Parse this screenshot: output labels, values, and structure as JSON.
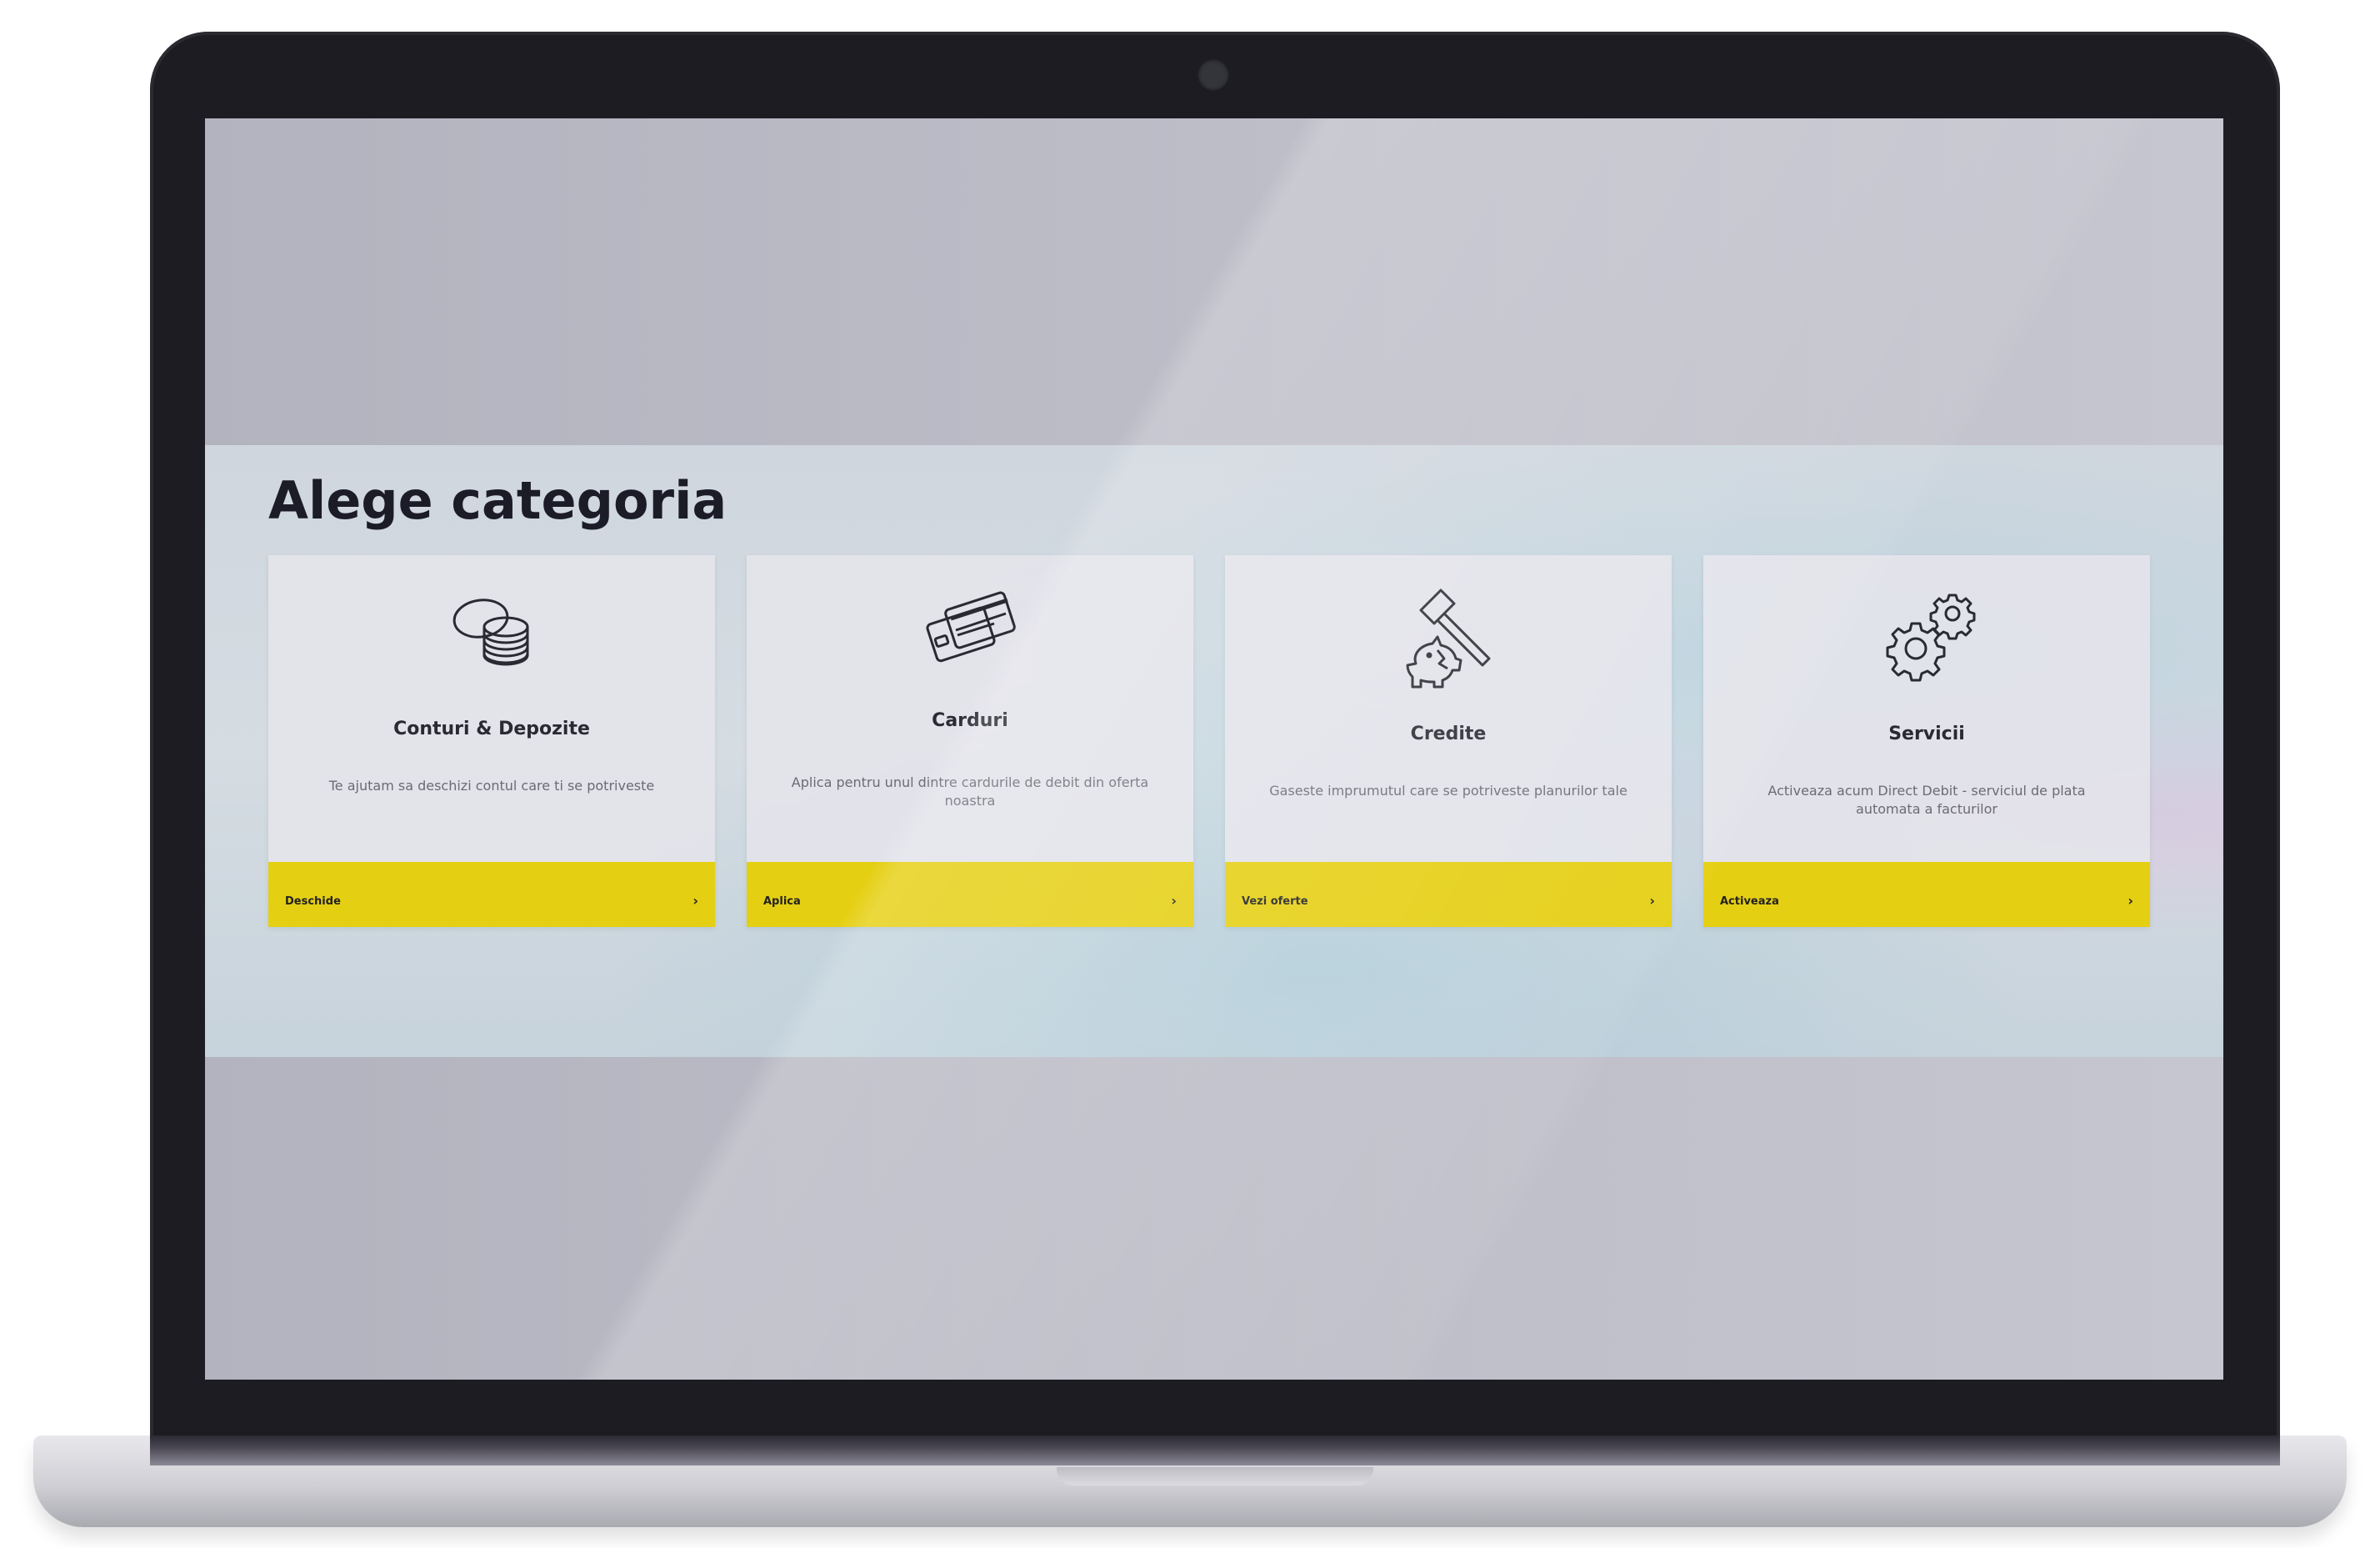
{
  "section": {
    "title": "Alege categoria"
  },
  "cards": [
    {
      "title": "Conturi & Depozite",
      "description": "Te ajutam sa deschizi contul care ti se potriveste",
      "button_label": "Deschide",
      "icon": "coins-icon"
    },
    {
      "title": "Carduri",
      "description": "Aplica pentru unul dintre cardurile de debit din oferta noastra",
      "button_label": "Aplica",
      "icon": "cards-icon"
    },
    {
      "title": "Credite",
      "description": "Gaseste imprumutul care se potriveste planurilor tale",
      "button_label": "Vezi oferte",
      "icon": "piggy-bank-hammer-icon"
    },
    {
      "title": "Servicii",
      "description": "Activeaza acum Direct Debit - serviciul de plata automata a facturilor",
      "button_label": "Activeaza",
      "icon": "gears-icon"
    }
  ],
  "chevron": "›",
  "colors": {
    "accent": "#e5cf12",
    "title_text": "#1c1c28",
    "card_bg": "#e4e4ea"
  }
}
